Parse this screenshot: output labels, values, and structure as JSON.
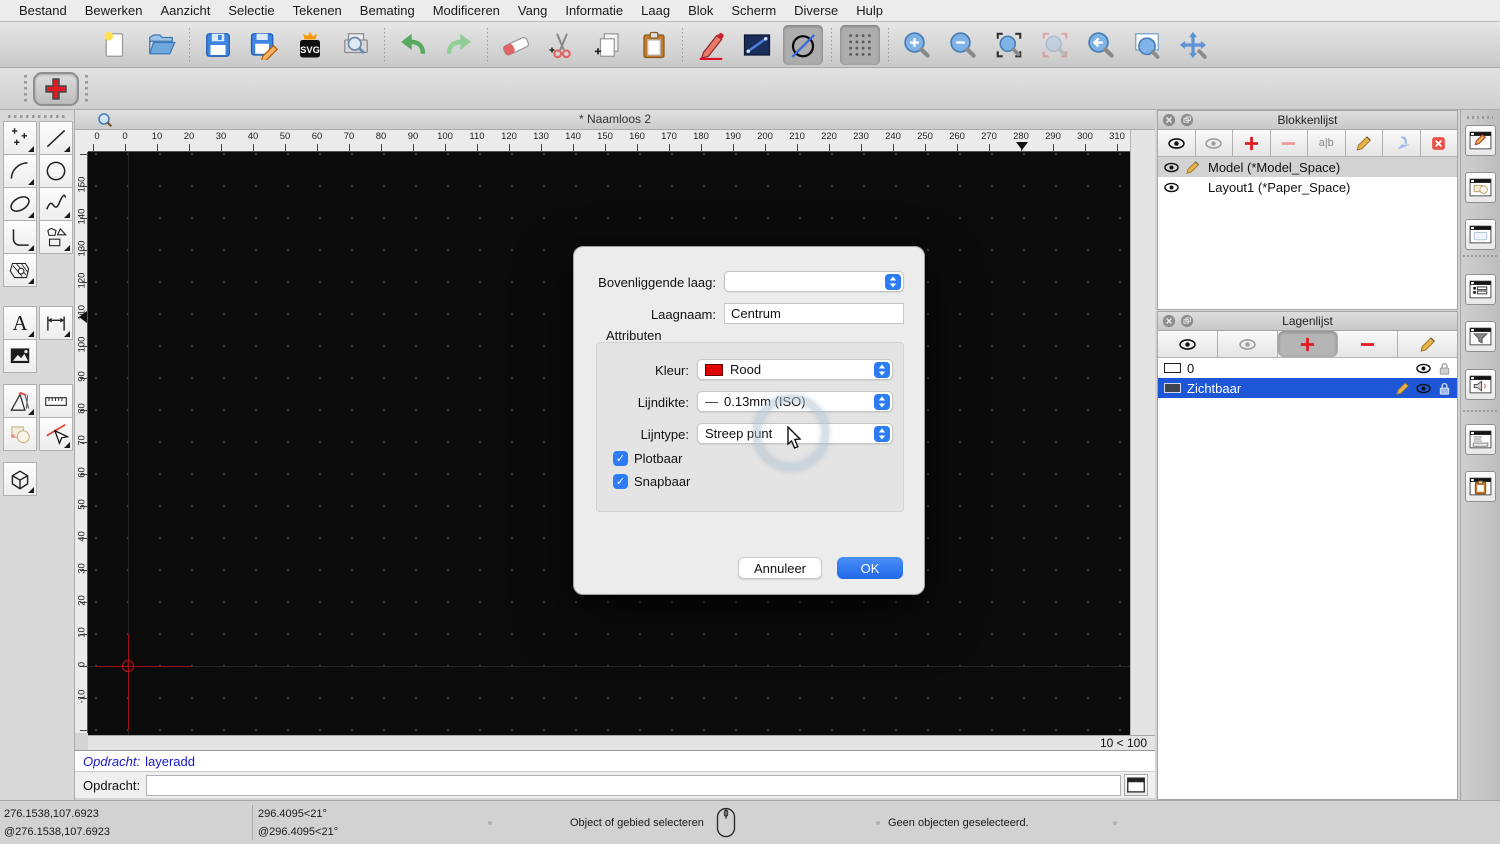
{
  "menu": {
    "items": [
      "Bestand",
      "Bewerken",
      "Aanzicht",
      "Selectie",
      "Tekenen",
      "Bemating",
      "Modificeren",
      "Vang",
      "Informatie",
      "Laag",
      "Blok",
      "Scherm",
      "Diverse",
      "Hulp"
    ]
  },
  "toolbar": {
    "buttons": [
      {
        "name": "new"
      },
      {
        "name": "open"
      },
      {
        "name": "sep"
      },
      {
        "name": "save"
      },
      {
        "name": "save-as"
      },
      {
        "name": "svg-export"
      },
      {
        "name": "print-preview"
      },
      {
        "name": "sep"
      },
      {
        "name": "undo"
      },
      {
        "name": "redo"
      },
      {
        "name": "sep"
      },
      {
        "name": "eraser"
      },
      {
        "name": "cut"
      },
      {
        "name": "copy"
      },
      {
        "name": "paste"
      },
      {
        "name": "sep"
      },
      {
        "name": "draw-pencil"
      },
      {
        "name": "line-format"
      },
      {
        "name": "circle-line",
        "pressed": true
      },
      {
        "name": "sep"
      },
      {
        "name": "grid-toggle",
        "pressed": true
      },
      {
        "name": "sep"
      },
      {
        "name": "zoom-in"
      },
      {
        "name": "zoom-out"
      },
      {
        "name": "zoom-fit"
      },
      {
        "name": "zoom-selected",
        "disabled": true
      },
      {
        "name": "zoom-previous"
      },
      {
        "name": "zoom-window"
      },
      {
        "name": "pan"
      }
    ]
  },
  "actions_toolbar": {
    "buttons": [
      {
        "name": "add-layer",
        "pressed": true
      }
    ]
  },
  "palette": {
    "rows": [
      [
        "points",
        "line"
      ],
      [
        "arc",
        "circle"
      ],
      [
        "ellipse",
        "spline"
      ],
      [
        "polyline",
        "shapes"
      ],
      [
        "hatch"
      ],
      [
        "text",
        "dimension"
      ],
      [
        "image"
      ],
      [
        "drafting",
        "ruler"
      ],
      [
        "overlap",
        "select-line"
      ],
      [
        "box3d"
      ]
    ]
  },
  "document": {
    "title": "* Naamloos 2",
    "scale_indicator": "10 < 100"
  },
  "rulers": {
    "h_corner": "0",
    "h_min": 0,
    "h_max": 310,
    "h_step": 10,
    "v_min": -10,
    "v_max": 150,
    "v_step": 10
  },
  "dialog": {
    "parent_layer_label": "Bovenliggende laag:",
    "parent_layer_value": "",
    "layer_name_label": "Laagnaam:",
    "layer_name_value": "Centrum",
    "attributes_label": "Attributen",
    "color_label": "Kleur:",
    "color_value": "Rood",
    "color_swatch": "#e00000",
    "lineweight_label": "Lijndikte:",
    "lineweight_dash": "—",
    "lineweight_value": "0.13mm (ISO)",
    "linetype_label": "Lijntype:",
    "linetype_value": "Streep punt",
    "plottable_label": "Plotbaar",
    "plottable_checked": true,
    "snappable_label": "Snapbaar",
    "snappable_checked": true,
    "cancel_label": "Annuleer",
    "ok_label": "OK"
  },
  "blocks_panel": {
    "title": "Blokkenlijst",
    "toolbar": [
      {
        "icon": "eye"
      },
      {
        "icon": "eye-gray"
      },
      {
        "icon": "plus"
      },
      {
        "icon": "minus-pale"
      },
      {
        "label": "a|b"
      },
      {
        "icon": "pencil"
      },
      {
        "icon": "arrow-insert"
      },
      {
        "icon": "x-box"
      }
    ],
    "rows": [
      {
        "label": "Model (*Model_Space)",
        "selected": true,
        "icons": [
          "eye",
          "pencil"
        ]
      },
      {
        "label": "Layout1 (*Paper_Space)",
        "selected": false,
        "icons": [
          "eye"
        ]
      }
    ]
  },
  "layers_panel": {
    "title": "Lagenlijst",
    "toolbar": [
      {
        "icon": "eye"
      },
      {
        "icon": "eye-gray"
      },
      {
        "icon": "plus",
        "pressed": true
      },
      {
        "icon": "minus"
      },
      {
        "icon": "pencil"
      }
    ],
    "rows": [
      {
        "label": "0",
        "selected": false,
        "swatch": "#ffffff",
        "right": [
          "eye",
          "lock"
        ]
      },
      {
        "label": "Zichtbaar",
        "selected": true,
        "swatch": "#3e4551",
        "right": [
          "pencil",
          "eye",
          "lock-blue"
        ]
      }
    ]
  },
  "side_strip": {
    "buttons": [
      "panel-blocks",
      "panel-shapes",
      "panel-empty",
      "sep",
      "panel-list",
      "panel-filter",
      "panel-speaker",
      "sep",
      "panel-command",
      "panel-clipboard"
    ]
  },
  "command": {
    "history_label": "Opdracht:",
    "history_value": "layeradd",
    "prompt_label": "Opdracht:",
    "input_value": ""
  },
  "status_bar": {
    "coords": "276.1538,107.6923",
    "coords_rel": "@276.1538,107.6923",
    "polar": "296.4095<21°",
    "polar_rel": "@296.4095<21°",
    "hint": "Object of gebied selecteren",
    "selection": "Geen objecten geselecteerd."
  },
  "colors": {
    "accent": "#2e7bf6",
    "selection_blue": "#1d57d8",
    "red": "#e01b24",
    "canvas": "#0b0b0b"
  }
}
